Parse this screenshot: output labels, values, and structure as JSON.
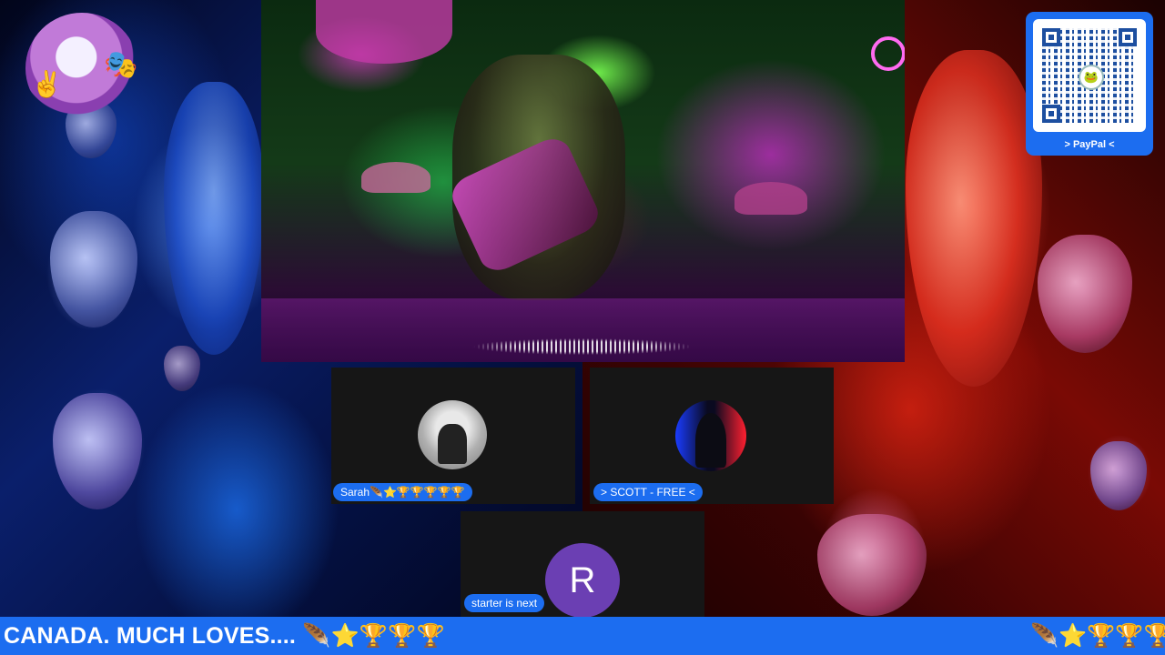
{
  "qr_card": {
    "label": "> PayPal <",
    "center_icon": "frog-emoji"
  },
  "participants": [
    {
      "name": "Sarah🪶⭐🏆🏆🏆🏆🏆",
      "avatar": "photo-horse-rider"
    },
    {
      "name": "> SCOTT - FREE <",
      "avatar": "photo-hooded-figure"
    },
    {
      "name": "starter is next",
      "avatar_letter": "R",
      "avatar_color": "#6b3fb3"
    }
  ],
  "ticker": {
    "text": "CANADA. MUCH LOVES.... 🪶⭐🏆🏆🏆",
    "tail": "🪶⭐🏆🏆🏆"
  },
  "colors": {
    "accent": "#1c6df0",
    "tile": "#161616"
  }
}
